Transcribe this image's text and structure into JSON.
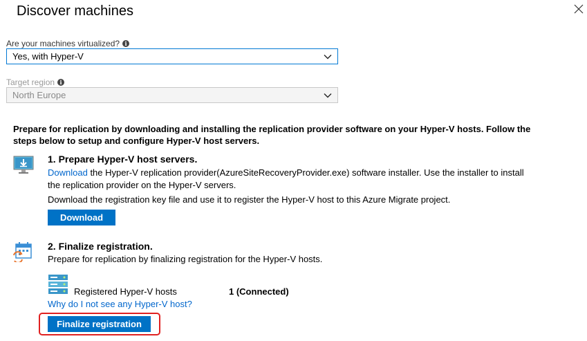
{
  "header": {
    "title": "Discover machines"
  },
  "virtualized": {
    "label": "Are your machines virtualized?",
    "value": "Yes, with Hyper-V"
  },
  "region": {
    "label": "Target region",
    "value": "North Europe"
  },
  "intro": "Prepare for replication by downloading and installing the replication provider software on your Hyper-V hosts. Follow the steps below to setup and configure Hyper-V host servers.",
  "step1": {
    "title": "1. Prepare Hyper-V host servers.",
    "link": "Download",
    "text": " the Hyper-V replication provider(AzureSiteRecoveryProvider.exe) software installer. Use the installer to install the replication provider on the Hyper-V servers.",
    "key_text": "Download the registration key file and use it to register the Hyper-V host to this Azure Migrate project.",
    "button": "Download"
  },
  "step2": {
    "title": "2. Finalize registration.",
    "text": "Prepare for replication by finalizing registration for the Hyper-V hosts.",
    "hosts_label": "Registered Hyper-V hosts",
    "hosts_value": "1 (Connected)",
    "help_link": "Why do I not see any Hyper-V host?",
    "button": "Finalize registration"
  },
  "icons": {
    "close": "close-icon",
    "info": "info-icon",
    "chevron": "chevron-down-icon",
    "download": "download-monitor-icon",
    "calendar": "calendar-refresh-icon",
    "server": "server-icon"
  },
  "colors": {
    "accent": "#0072c6",
    "link": "#0066cc",
    "highlight": "#e02020",
    "select_border": "#0078d4"
  }
}
